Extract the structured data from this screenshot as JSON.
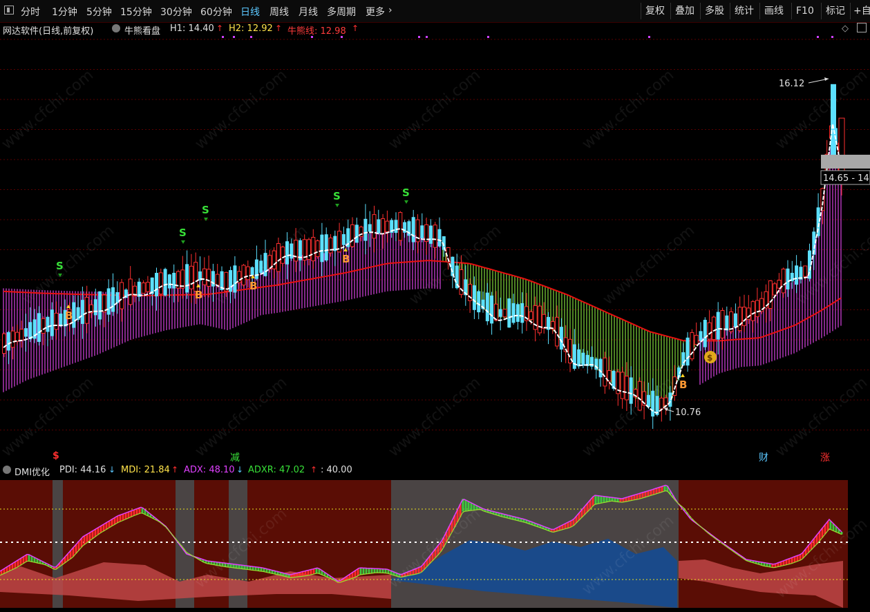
{
  "toolbar": {
    "periods": [
      "分时",
      "1分钟",
      "5分钟",
      "15分钟",
      "30分钟",
      "60分钟",
      "日线",
      "周线",
      "月线",
      "多周期",
      "更多"
    ],
    "active_period": "日线",
    "more_chevron": "›",
    "right_buttons": [
      "复权",
      "叠加",
      "多股",
      "统计",
      "画线",
      "F10",
      "标记",
      "+自"
    ]
  },
  "info": {
    "security": "网达软件(日线,前复权)",
    "indicator": "牛熊看盘",
    "h1": "H1: 14.40",
    "h2": "H2: 12.92",
    "bull_bear": "牛熊线: 12.98"
  },
  "price": {
    "high_label": "16.12",
    "low_label": "10.76",
    "price_box": "14.65 - 14",
    "markers": {
      "s": "S",
      "b": "B"
    }
  },
  "events": [
    {
      "label": "$",
      "color": "#ff3030"
    },
    {
      "label": "减",
      "color": "#38e038"
    },
    {
      "label": "财",
      "color": "#5cc8ff"
    },
    {
      "label": "涨",
      "color": "#ff3030"
    }
  ],
  "dmi": {
    "name": "DMI优化",
    "pdi": "PDI: 44.16",
    "mdi": "MDI: 21.84",
    "adx": "ADX: 48.10",
    "adxr": "ADXR: 47.02",
    "level": ": 40.00"
  },
  "watermark": "www.cfchi.com",
  "colors": {
    "up": "#ff3030",
    "down": "#5ce0ff",
    "ma_white": "#ffffff",
    "bull_red": "#e81010",
    "band_bull": "#d040d8",
    "band_bear": "#7ccf3a",
    "dmi_bg_red": "#5a0d05",
    "dmi_bg_gray": "#4a4444"
  }
}
